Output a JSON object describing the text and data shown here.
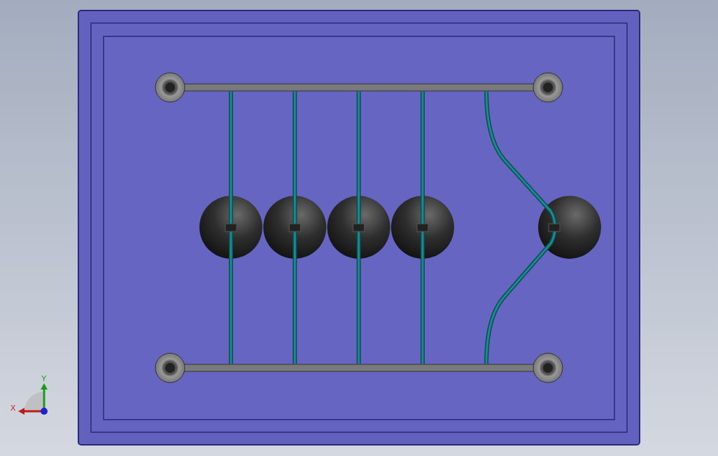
{
  "viewport": {
    "pendulums": [
      {
        "kind": "resting"
      },
      {
        "kind": "resting"
      },
      {
        "kind": "resting"
      },
      {
        "kind": "resting"
      },
      {
        "kind": "swung"
      }
    ],
    "axis_triad": {
      "x_label": "X",
      "y_label": "Y"
    }
  }
}
